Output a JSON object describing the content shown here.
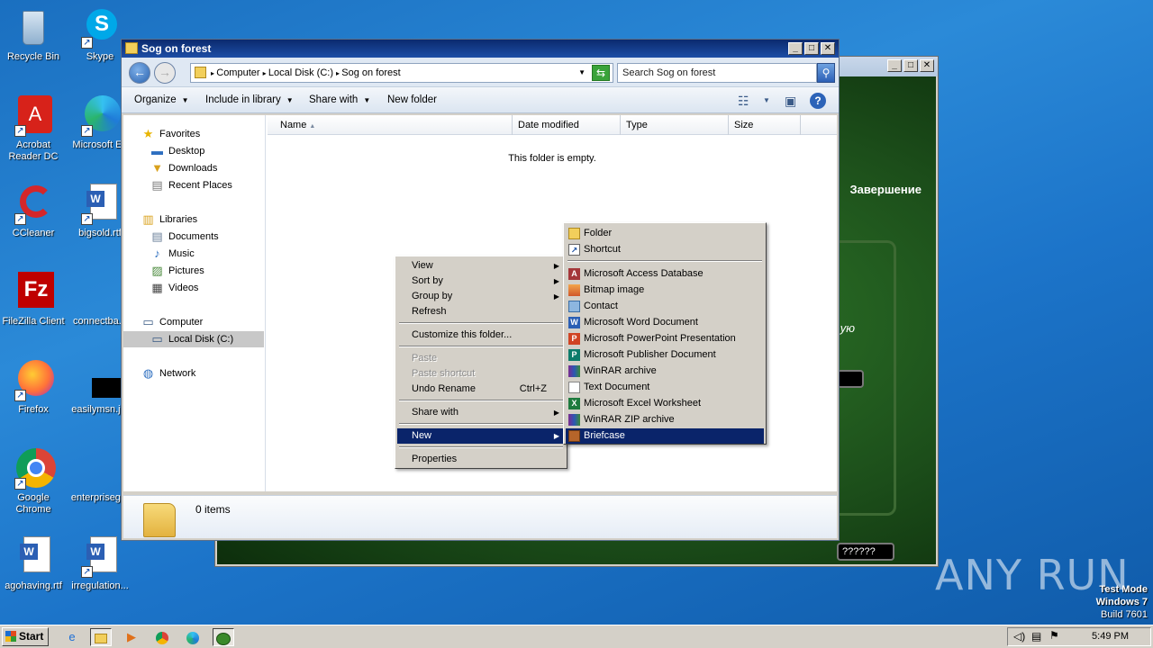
{
  "desktop": {
    "icons": [
      {
        "label": "Recycle Bin",
        "icon": "recycle-bin-icon"
      },
      {
        "label": "Skype",
        "icon": "skype-icon"
      },
      {
        "label": "Acrobat Reader DC",
        "icon": "acrobat-icon"
      },
      {
        "label": "Microsoft Ed",
        "icon": "edge-icon"
      },
      {
        "label": "CCleaner",
        "icon": "ccleaner-icon"
      },
      {
        "label": "bigsold.rtf",
        "icon": "word-doc-icon"
      },
      {
        "label": "FileZilla Client",
        "icon": "filezilla-icon"
      },
      {
        "label": "connectba...",
        "icon": "blank-file-icon"
      },
      {
        "label": "Firefox",
        "icon": "firefox-icon"
      },
      {
        "label": "easilymsn.j...",
        "icon": "black-image-icon"
      },
      {
        "label": "Google Chrome",
        "icon": "chrome-icon"
      },
      {
        "label": "enterpriseg...",
        "icon": "blank-file-icon"
      },
      {
        "label": "agohaving.rtf",
        "icon": "word-doc-icon"
      },
      {
        "label": "irregulation...",
        "icon": "word-doc-icon"
      }
    ]
  },
  "background_window": {
    "heading": "Завершение",
    "side_text": "ую",
    "field_text": "??????"
  },
  "explorer": {
    "title": "Sog on forest",
    "breadcrumb": [
      "Computer",
      "Local Disk (C:)",
      "Sog on forest"
    ],
    "search_placeholder": "Search Sog on forest",
    "toolbar": {
      "organize": "Organize",
      "include_in_library": "Include in library",
      "share_with": "Share with",
      "new_folder": "New folder"
    },
    "nav": {
      "favorites": "Favorites",
      "desktop": "Desktop",
      "downloads": "Downloads",
      "recent_places": "Recent Places",
      "libraries": "Libraries",
      "documents": "Documents",
      "music": "Music",
      "pictures": "Pictures",
      "videos": "Videos",
      "computer": "Computer",
      "local_disk": "Local Disk (C:)",
      "network": "Network"
    },
    "columns": {
      "name": "Name",
      "date_modified": "Date modified",
      "type": "Type",
      "size": "Size"
    },
    "empty_message": "This folder is empty.",
    "status_items": "0 items"
  },
  "context_menu": {
    "view": "View",
    "sort_by": "Sort by",
    "group_by": "Group by",
    "refresh": "Refresh",
    "customize": "Customize this folder...",
    "paste": "Paste",
    "paste_shortcut": "Paste shortcut",
    "undo_rename": "Undo Rename",
    "undo_shortcut": "Ctrl+Z",
    "share_with": "Share with",
    "new": "New",
    "properties": "Properties"
  },
  "new_menu": {
    "items": [
      "Folder",
      "Shortcut",
      "Microsoft Access Database",
      "Bitmap image",
      "Contact",
      "Microsoft Word Document",
      "Microsoft PowerPoint Presentation",
      "Microsoft Publisher Document",
      "WinRAR archive",
      "Text Document",
      "Microsoft Excel Worksheet",
      "WinRAR ZIP archive",
      "Briefcase"
    ],
    "highlighted": "Briefcase"
  },
  "watermark": {
    "brand": "ANY RUN",
    "line1": "Test Mode",
    "line2": "Windows 7",
    "line3": "Build 7601"
  },
  "taskbar": {
    "start": "Start",
    "time": "5:49 PM"
  }
}
